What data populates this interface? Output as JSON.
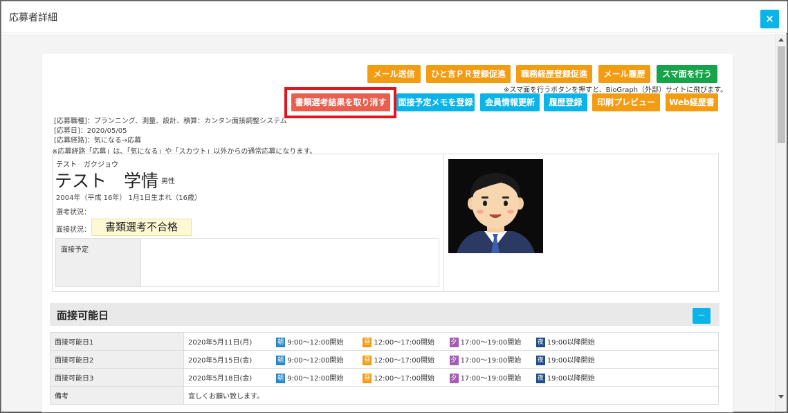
{
  "modal": {
    "title": "応募者詳細",
    "close_label": "×"
  },
  "actions_row1": [
    {
      "label": "メール送信",
      "color": "#f39c12"
    },
    {
      "label": "ひと言ＰＲ登録促進",
      "color": "#f39c12"
    },
    {
      "label": "職務経歴登録促進",
      "color": "#f39c12"
    },
    {
      "label": "メール履歴",
      "color": "#f39c12"
    },
    {
      "label": "スマ面を行う",
      "color": "#16a34a"
    }
  ],
  "smamen_note": "※スマ面を行うボタンを押すと、BioGraph（外部）サイトに飛びます。",
  "actions_row2": [
    {
      "label": "書類選考結果を取り消す",
      "color": "#e95f4f"
    },
    {
      "label": "面接予定メモを登録",
      "color": "#0bb4e8"
    },
    {
      "label": "会員情報更新",
      "color": "#0bb4e8"
    },
    {
      "label": "履歴登録",
      "color": "#0bb4e8"
    },
    {
      "label": "印刷プレビュー",
      "color": "#f39c12"
    },
    {
      "label": "Web経歴書",
      "color": "#f39c12"
    }
  ],
  "application": {
    "job": "[応募職種]：プランニング、測量、設計、積算：カンタン面接調整システム",
    "date": "[応募日]：2020/05/05",
    "route": "[応募経路]：気になる→応募",
    "route_note": "※応募経路「応募」は、「気になる」や「スカウト」以外からの通常応募になります。"
  },
  "applicant": {
    "kana": "テスト　ガクジョウ",
    "name": "テスト　学情",
    "gender": "男性",
    "birth": "2004年（平成 16年） 1月1日生まれ（16歳）",
    "selection_label": "選考状況：",
    "interview_status_label": "面接状況：",
    "interview_status": "書類選考不合格",
    "schedule_label": "面接予定",
    "schedule_value": ""
  },
  "availability": {
    "section_title": "面接可能日",
    "collapse_label": "－",
    "rows": [
      {
        "label": "面接可能日1",
        "date": "2020年5月11日(月)",
        "slots": [
          {
            "tag": "朝",
            "text": "9:00〜12:00開始"
          },
          {
            "tag": "昼",
            "text": "12:00〜17:00開始"
          },
          {
            "tag": "夕",
            "text": "17:00〜19:00開始"
          },
          {
            "tag": "夜",
            "text": "19:00以降開始"
          }
        ]
      },
      {
        "label": "面接可能日2",
        "date": "2020年5月15日(金)",
        "slots": [
          {
            "tag": "朝",
            "text": "9:00〜12:00開始"
          },
          {
            "tag": "昼",
            "text": "12:00〜17:00開始"
          },
          {
            "tag": "夕",
            "text": "17:00〜19:00開始"
          },
          {
            "tag": "夜",
            "text": "19:00以降開始"
          }
        ]
      },
      {
        "label": "面接可能日3",
        "date": "2020年5月18日(金)",
        "slots": [
          {
            "tag": "朝",
            "text": "9:00〜12:00開始"
          },
          {
            "tag": "昼",
            "text": "12:00〜17:00開始"
          },
          {
            "tag": "夕",
            "text": "17:00〜19:00開始"
          },
          {
            "tag": "夜",
            "text": "19:00以降開始"
          }
        ]
      }
    ],
    "remarks_label": "備考",
    "remarks": "宜しくお願い致します。"
  }
}
